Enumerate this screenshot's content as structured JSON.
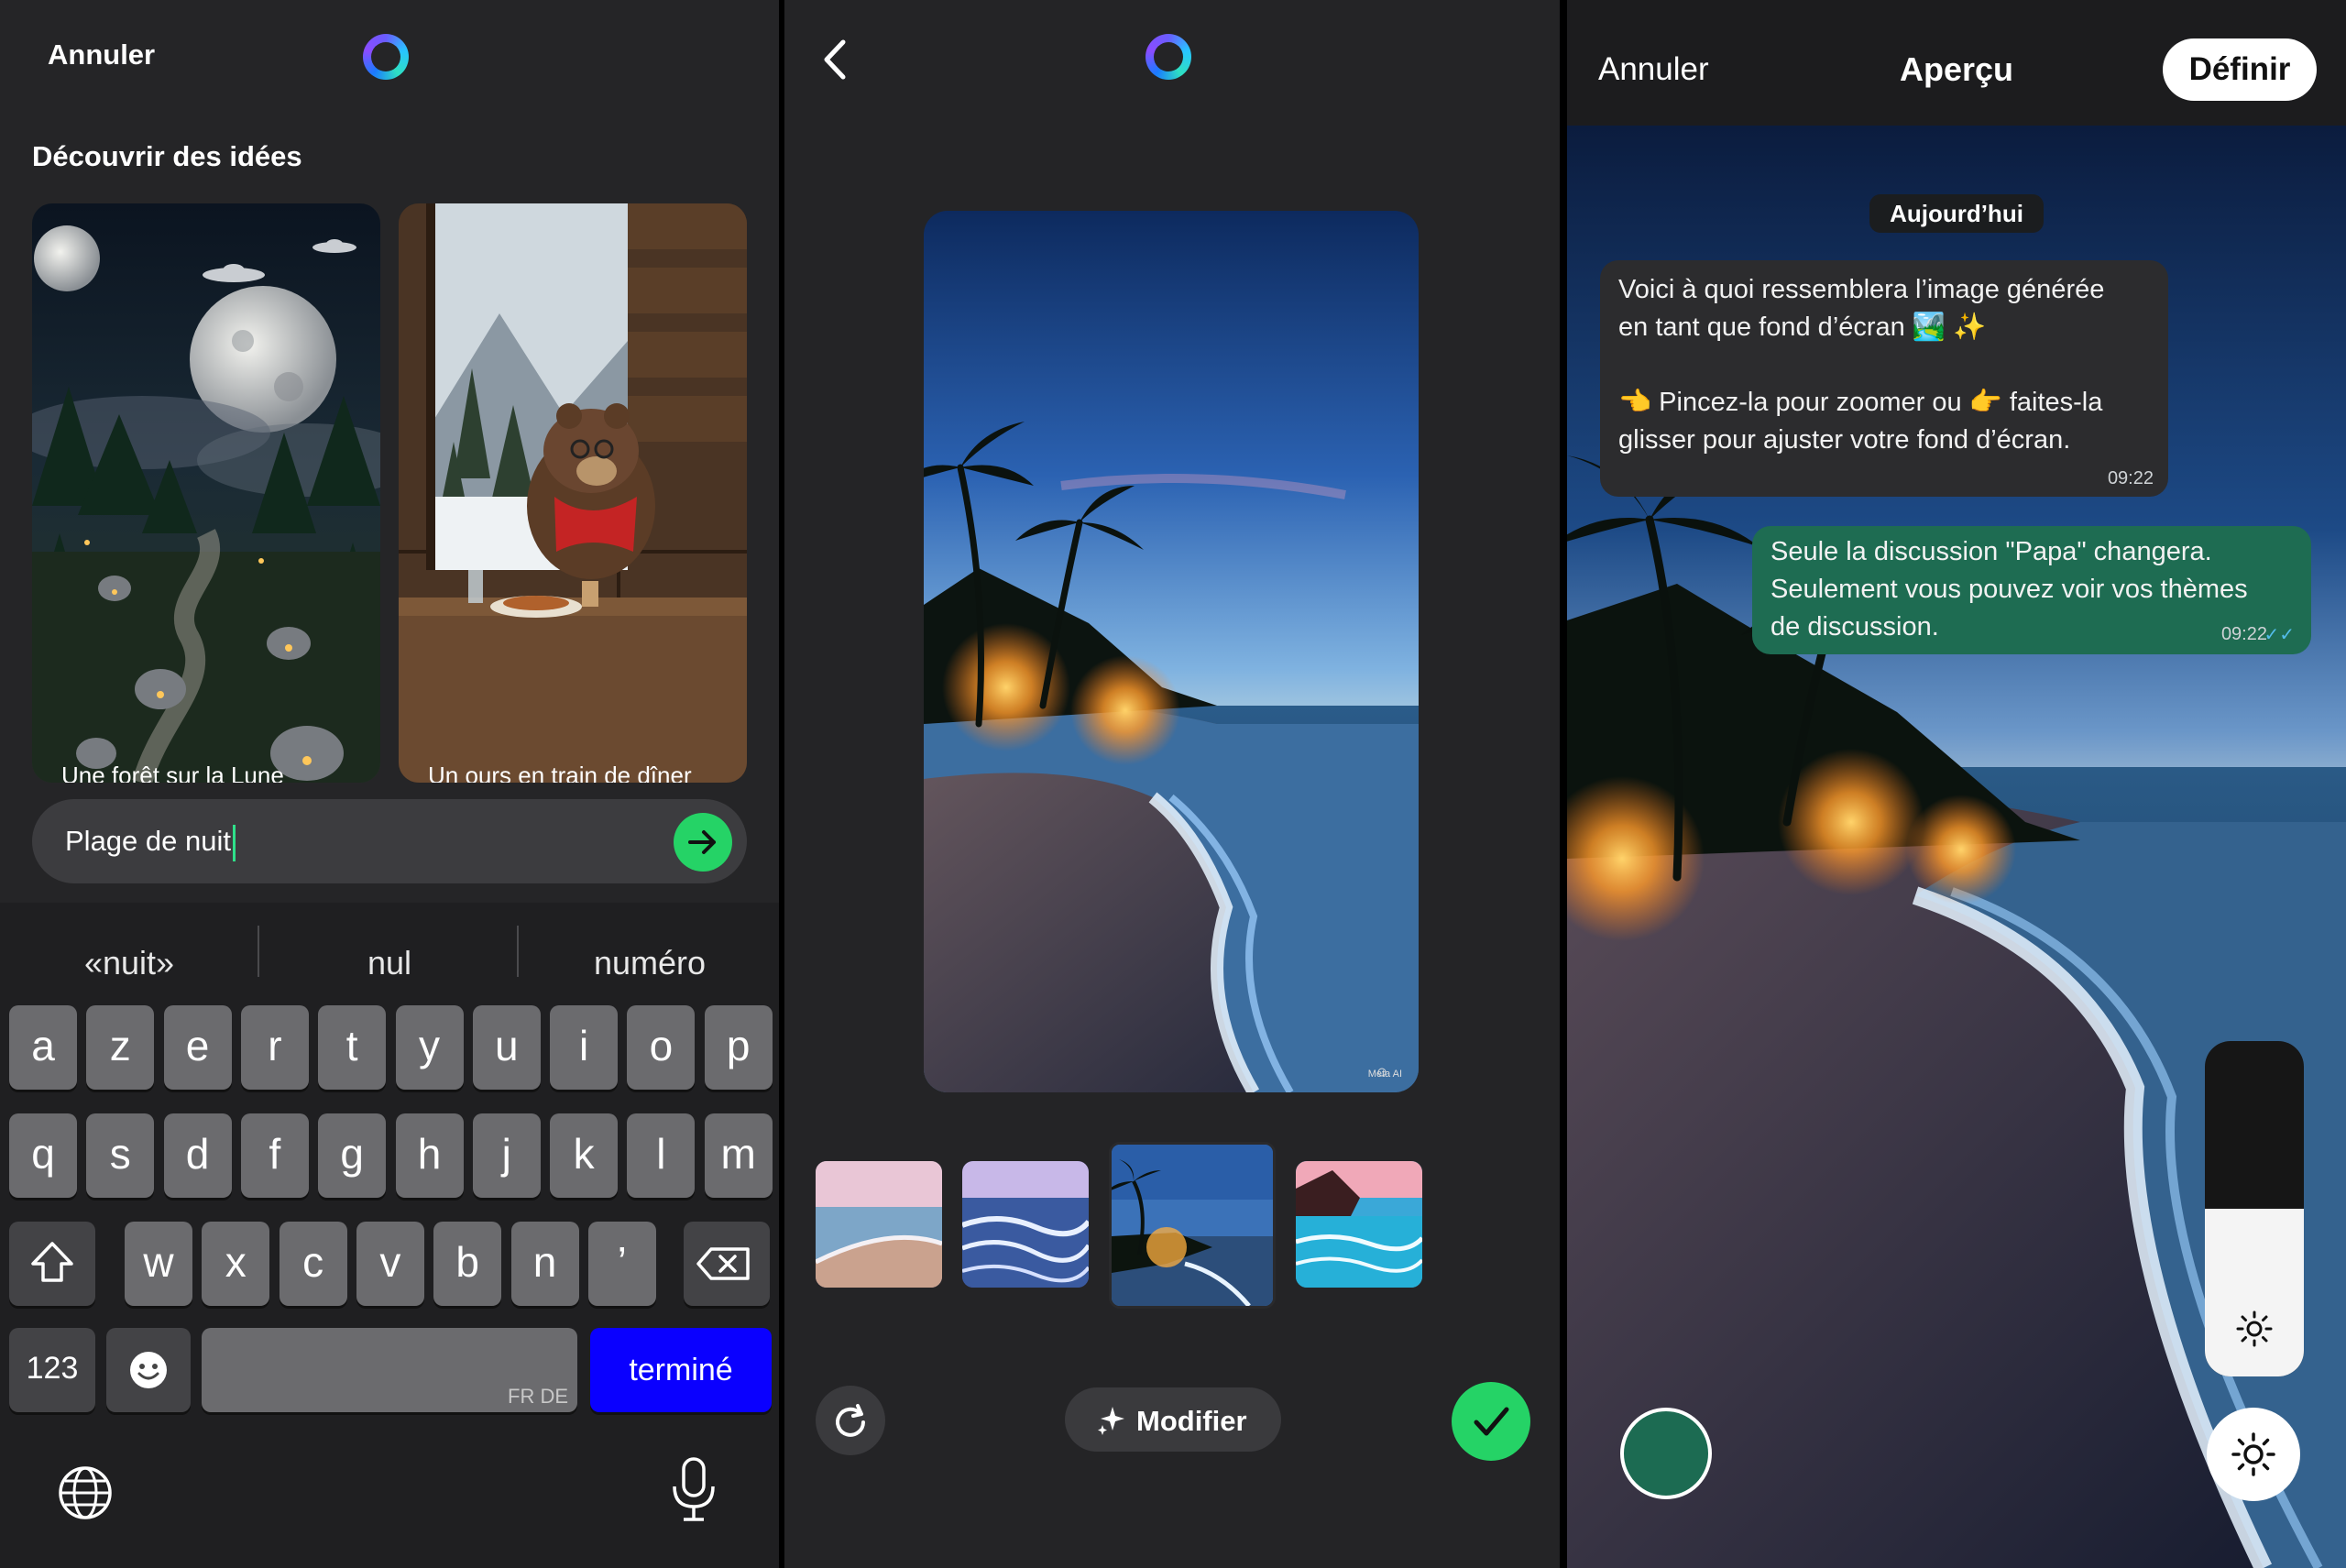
{
  "panel1": {
    "cancel_label": "Annuler",
    "section_title": "Découvrir des idées",
    "ideas": [
      {
        "caption": "Une forêt sur la Lune"
      },
      {
        "caption": "Un ours en train de dîner"
      }
    ],
    "prompt_value": "Plage de nuit",
    "suggestions": [
      "«nuit»",
      "nul",
      "numéro"
    ],
    "keyboard": {
      "row1": [
        "a",
        "z",
        "e",
        "r",
        "t",
        "y",
        "u",
        "i",
        "o",
        "p"
      ],
      "row2": [
        "q",
        "s",
        "d",
        "f",
        "g",
        "h",
        "j",
        "k",
        "l",
        "m"
      ],
      "row3": [
        "w",
        "x",
        "c",
        "v",
        "b",
        "n",
        "’"
      ],
      "numbers_label": "123",
      "space_lang": "FR DE",
      "done_label": "terminé"
    }
  },
  "panel2": {
    "watermark": "Meta AI",
    "modify_label": "Modifier",
    "selected_thumb": 3
  },
  "panel3": {
    "cancel_label": "Annuler",
    "title": "Aperçu",
    "define_label": "Définir",
    "date_label": "Aujourd’hui",
    "incoming": {
      "line1": "Voici à quoi ressemblera l’image générée",
      "line2": "en tant que fond d’écran 🏞️ ✨",
      "line3": "👈 Pincez-la pour zoomer ou 👉 faites-la",
      "line4": "glisser pour ajuster votre fond d’écran.",
      "time": "09:22"
    },
    "outgoing": {
      "line1": "Seule la discussion \"Papa\" changera.",
      "line2": "Seulement vous pouvez voir vos thèmes",
      "line3": "de discussion.",
      "time": "09:22",
      "status": "✓✓"
    },
    "brightness_level": 0.5,
    "accent_color": "#1c6b52"
  },
  "colors": {
    "whatsapp_green": "#25d366",
    "outgoing_bubble": "#1e6c52",
    "keyboard_done": "#0a00ff"
  }
}
